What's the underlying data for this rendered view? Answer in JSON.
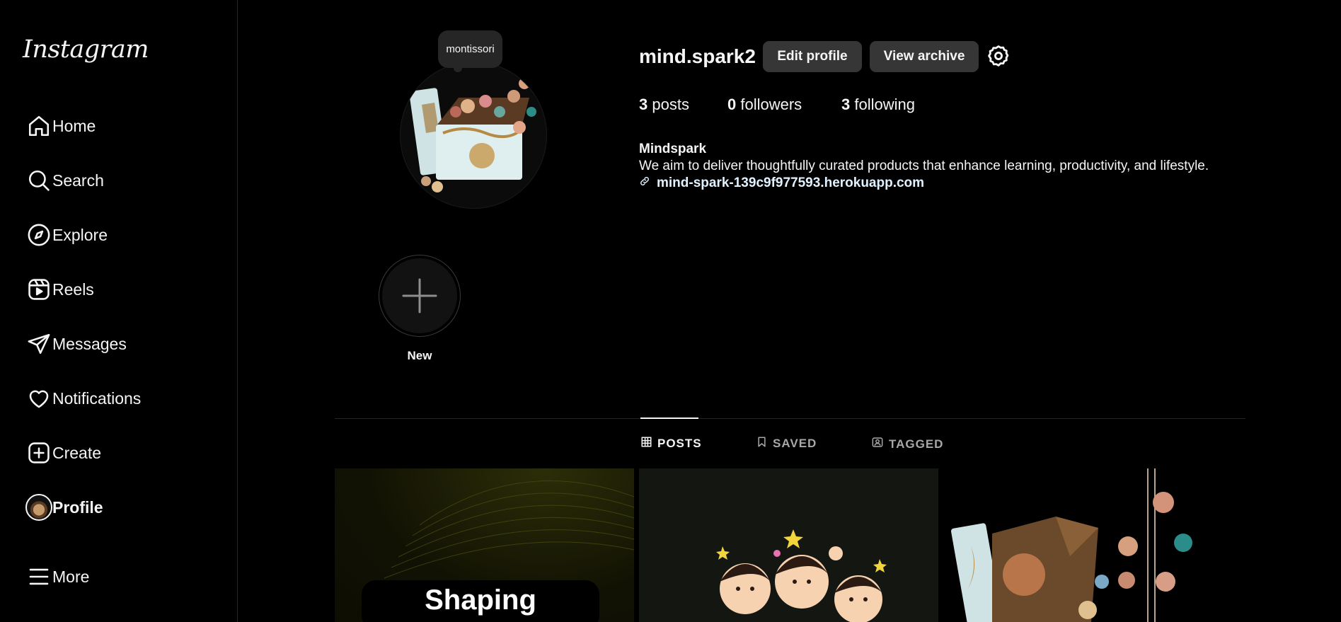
{
  "sidebar": {
    "logo": "Instagram",
    "items": [
      {
        "label": "Home",
        "icon": "home-icon"
      },
      {
        "label": "Search",
        "icon": "search-icon"
      },
      {
        "label": "Explore",
        "icon": "compass-icon"
      },
      {
        "label": "Reels",
        "icon": "reels-icon"
      },
      {
        "label": "Messages",
        "icon": "paper-plane-icon"
      },
      {
        "label": "Notifications",
        "icon": "heart-icon"
      },
      {
        "label": "Create",
        "icon": "plus-square-icon"
      },
      {
        "label": "Profile",
        "icon": "avatar",
        "active": true
      }
    ],
    "more_label": "More"
  },
  "profile": {
    "tooltip": "montissori",
    "username": "mind.spark2",
    "edit_label": "Edit profile",
    "archive_label": "View archive",
    "stats": {
      "posts_count": "3",
      "posts_label": "posts",
      "followers_count": "0",
      "followers_label": "followers",
      "following_count": "3",
      "following_label": "following"
    },
    "bio_name": "Mindspark",
    "bio_text": "We aim to deliver thoughtfully curated products that enhance learning, productivity, and lifestyle.",
    "bio_link": "mind-spark-139c9f977593.herokuapp.com"
  },
  "highlights": {
    "new_label": "New"
  },
  "tabs": [
    {
      "label": "POSTS",
      "active": true
    },
    {
      "label": "SAVED",
      "active": false
    },
    {
      "label": "TAGGED",
      "active": false
    }
  ],
  "posts": {
    "first_caption": "Shaping"
  },
  "colors": {
    "background": "#000000",
    "text": "#f5f5f5",
    "button": "#363636",
    "link": "#e0f1ff",
    "muted": "#a8a8a8"
  }
}
